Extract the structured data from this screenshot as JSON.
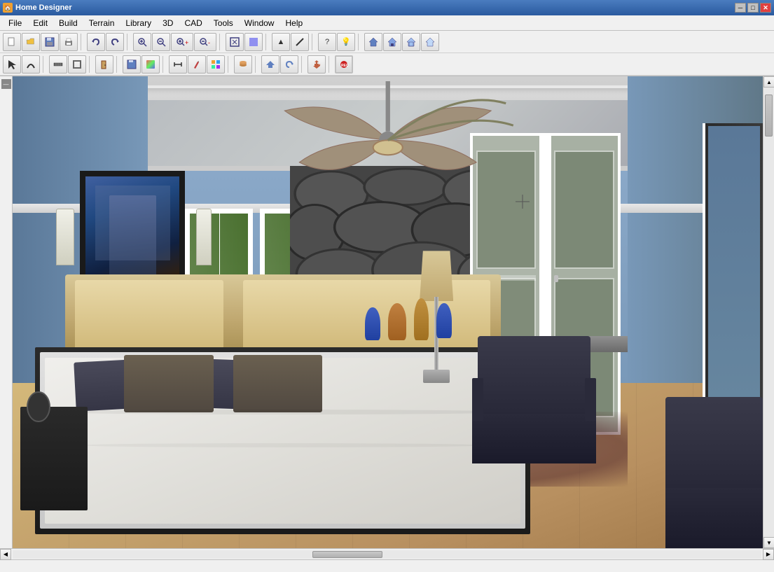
{
  "app": {
    "title": "Home Designer",
    "icon": "🏠"
  },
  "title_bar": {
    "title": "Home Designer",
    "min_btn": "─",
    "max_btn": "□",
    "close_btn": "✕"
  },
  "menu": {
    "items": [
      "File",
      "Edit",
      "Build",
      "Terrain",
      "Library",
      "3D",
      "CAD",
      "Tools",
      "Window",
      "Help"
    ]
  },
  "toolbar1": {
    "buttons": [
      "📄",
      "📂",
      "💾",
      "🖨",
      "↩",
      "↪",
      "🔍",
      "🔎",
      "🔍+",
      "🔍-",
      "□□",
      "◻◻",
      "↔",
      "↕",
      "⊞",
      "⊡",
      "📐",
      "📏",
      "?",
      "💡",
      "🏠",
      "🏡",
      "⛺",
      "🏛"
    ]
  },
  "toolbar2": {
    "buttons": [
      "↖",
      "〜",
      "─",
      "▦",
      "⌂",
      "💾",
      "□",
      "▣",
      "↗",
      "🖊",
      "🌈",
      "✱",
      "🔧",
      "↑",
      "⟳",
      "⏺"
    ]
  },
  "status_bar": {
    "text": ""
  },
  "viewport": {
    "scene": "3D Bedroom Interior"
  }
}
